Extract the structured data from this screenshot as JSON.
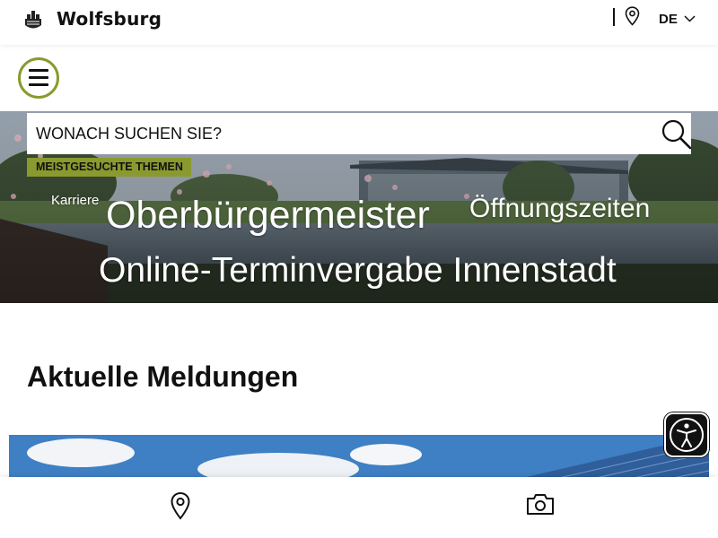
{
  "header": {
    "brand": "Wolfsburg",
    "logo_icon": "wolfsburg-castle-crest-icon",
    "location_icon": "map-pin-icon",
    "language": "DE",
    "language_icon": "chevron-down-icon"
  },
  "nav": {
    "menu_icon": "hamburger-menu-icon",
    "accent_color": "#8a9a2e"
  },
  "search": {
    "placeholder": "WONACH SUCHEN SIE?",
    "icon": "search-icon"
  },
  "top_topics": {
    "label": "MEISTGESUCHTE THEMEN",
    "links": [
      "Karriere",
      "Oberbürgermeister",
      "Öffnungszeiten",
      "Online-Terminvergabe Innenstadt"
    ]
  },
  "news": {
    "title": "Aktuelle Meldungen"
  },
  "accessibility": {
    "icon": "accessibility-person-icon"
  },
  "bottom_bar": {
    "items": [
      {
        "icon": "map-pin-icon"
      },
      {
        "icon": "camera-icon"
      }
    ]
  }
}
